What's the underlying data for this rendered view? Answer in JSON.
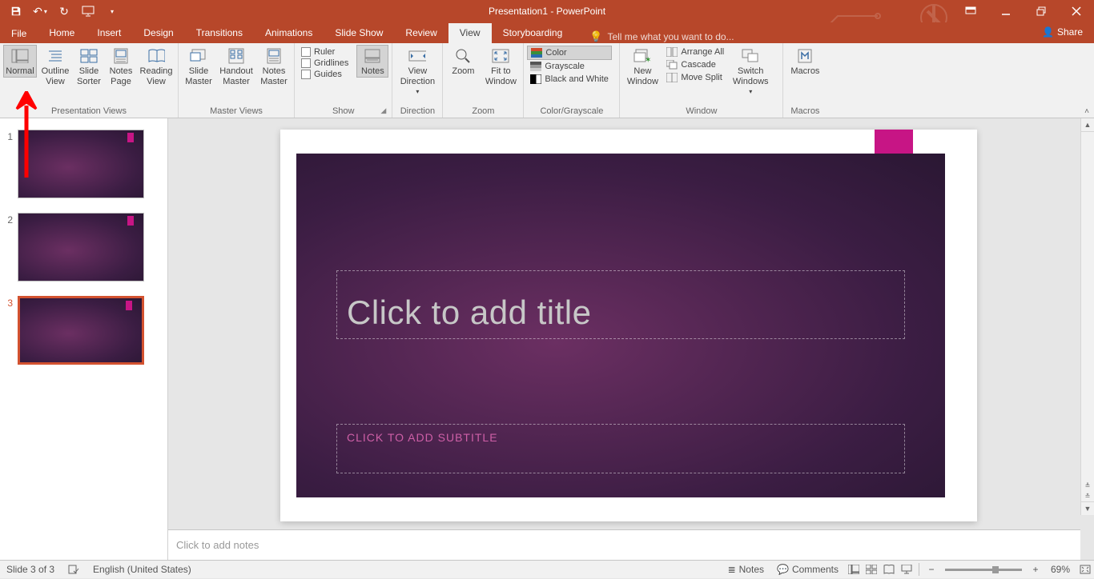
{
  "title": "Presentation1 - PowerPoint",
  "tabs": {
    "file": "File",
    "items": [
      "Home",
      "Insert",
      "Design",
      "Transitions",
      "Animations",
      "Slide Show",
      "Review",
      "View",
      "Storyboarding"
    ],
    "active": "View",
    "tell_me": "Tell me what you want to do...",
    "share": "Share"
  },
  "ribbon": {
    "presentation_views": {
      "label": "Presentation Views",
      "normal": "Normal",
      "outline": "Outline\nView",
      "sorter": "Slide\nSorter",
      "notes_page": "Notes\nPage",
      "reading": "Reading\nView"
    },
    "master_views": {
      "label": "Master Views",
      "slide_master": "Slide\nMaster",
      "handout": "Handout\nMaster",
      "notes_master": "Notes\nMaster"
    },
    "show": {
      "label": "Show",
      "ruler": "Ruler",
      "gridlines": "Gridlines",
      "guides": "Guides",
      "notes": "Notes"
    },
    "direction": {
      "label": "Direction",
      "btn": "View\nDirection"
    },
    "zoom": {
      "label": "Zoom",
      "zoom": "Zoom",
      "fit": "Fit to\nWindow"
    },
    "color_grayscale": {
      "label": "Color/Grayscale",
      "color": "Color",
      "grayscale": "Grayscale",
      "bw": "Black and White"
    },
    "window": {
      "label": "Window",
      "new_window": "New\nWindow",
      "arrange": "Arrange All",
      "cascade": "Cascade",
      "move_split": "Move Split",
      "switch": "Switch\nWindows"
    },
    "macros": {
      "label": "Macros",
      "btn": "Macros"
    }
  },
  "thumbs": {
    "selected": 3,
    "items": [
      1,
      2,
      3
    ]
  },
  "slide": {
    "title_placeholder": "Click to add title",
    "subtitle_placeholder": "CLICK TO ADD SUBTITLE"
  },
  "notes_placeholder": "Click to add notes",
  "status": {
    "slide": "Slide 3 of 3",
    "lang": "English (United States)",
    "notes": "Notes",
    "comments": "Comments",
    "zoom": "69%"
  }
}
